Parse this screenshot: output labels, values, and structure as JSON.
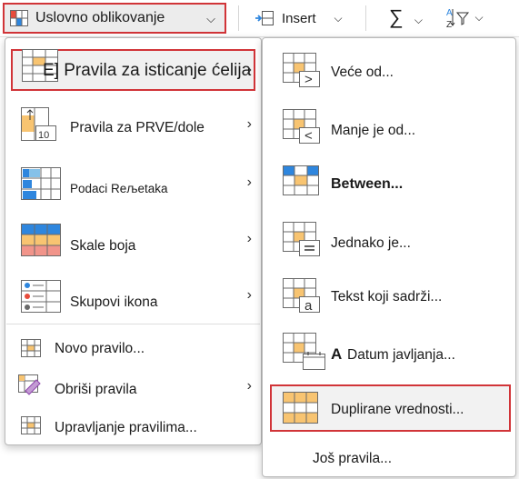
{
  "ribbon": {
    "conditional_formatting_label": "Uslovno oblikovanje",
    "insert_label": "Insert"
  },
  "left_menu": {
    "items": [
      {
        "label": "E] Pravila za isticanje ćelija",
        "icon": "highlight-cells-rules-icon"
      },
      {
        "label": "Pravila za PRVE/dole",
        "icon": "top-bottom-rules-icon"
      },
      {
        "label": "Podaci Reљetaka",
        "icon": "data-bars-icon"
      },
      {
        "label": "Skale boja",
        "icon": "color-scales-icon"
      },
      {
        "label": "Skupovi ikona",
        "icon": "icon-sets-icon"
      },
      {
        "label": "Novo pravilo...",
        "icon": "new-rule-icon"
      },
      {
        "label": "Obriši pravila",
        "icon": "clear-rules-icon"
      },
      {
        "label": "Upravljanje pravilima...",
        "icon": "manage-rules-icon"
      }
    ]
  },
  "right_menu": {
    "items": [
      {
        "label": "Veće od...",
        "icon": "greater-than-icon"
      },
      {
        "label": "Manje je od...",
        "icon": "less-than-icon"
      },
      {
        "label": "Between...",
        "icon": "between-icon"
      },
      {
        "label": "Jednako je...",
        "icon": "equal-to-icon"
      },
      {
        "label": "Tekst koji sadrži...",
        "icon": "text-contains-icon"
      },
      {
        "label": "Datum javljanja...",
        "icon": "date-occurring-icon",
        "prefix": "A"
      },
      {
        "label": "Duplirane vrednosti...",
        "icon": "duplicate-values-icon"
      },
      {
        "label": "Još pravila...",
        "icon": ""
      }
    ]
  },
  "colors": {
    "highlight_border": "#d13438",
    "cell_fill_orange": "#f8c471",
    "cell_fill_blue": "#2e86de",
    "cell_fill_red": "#f1948a"
  }
}
